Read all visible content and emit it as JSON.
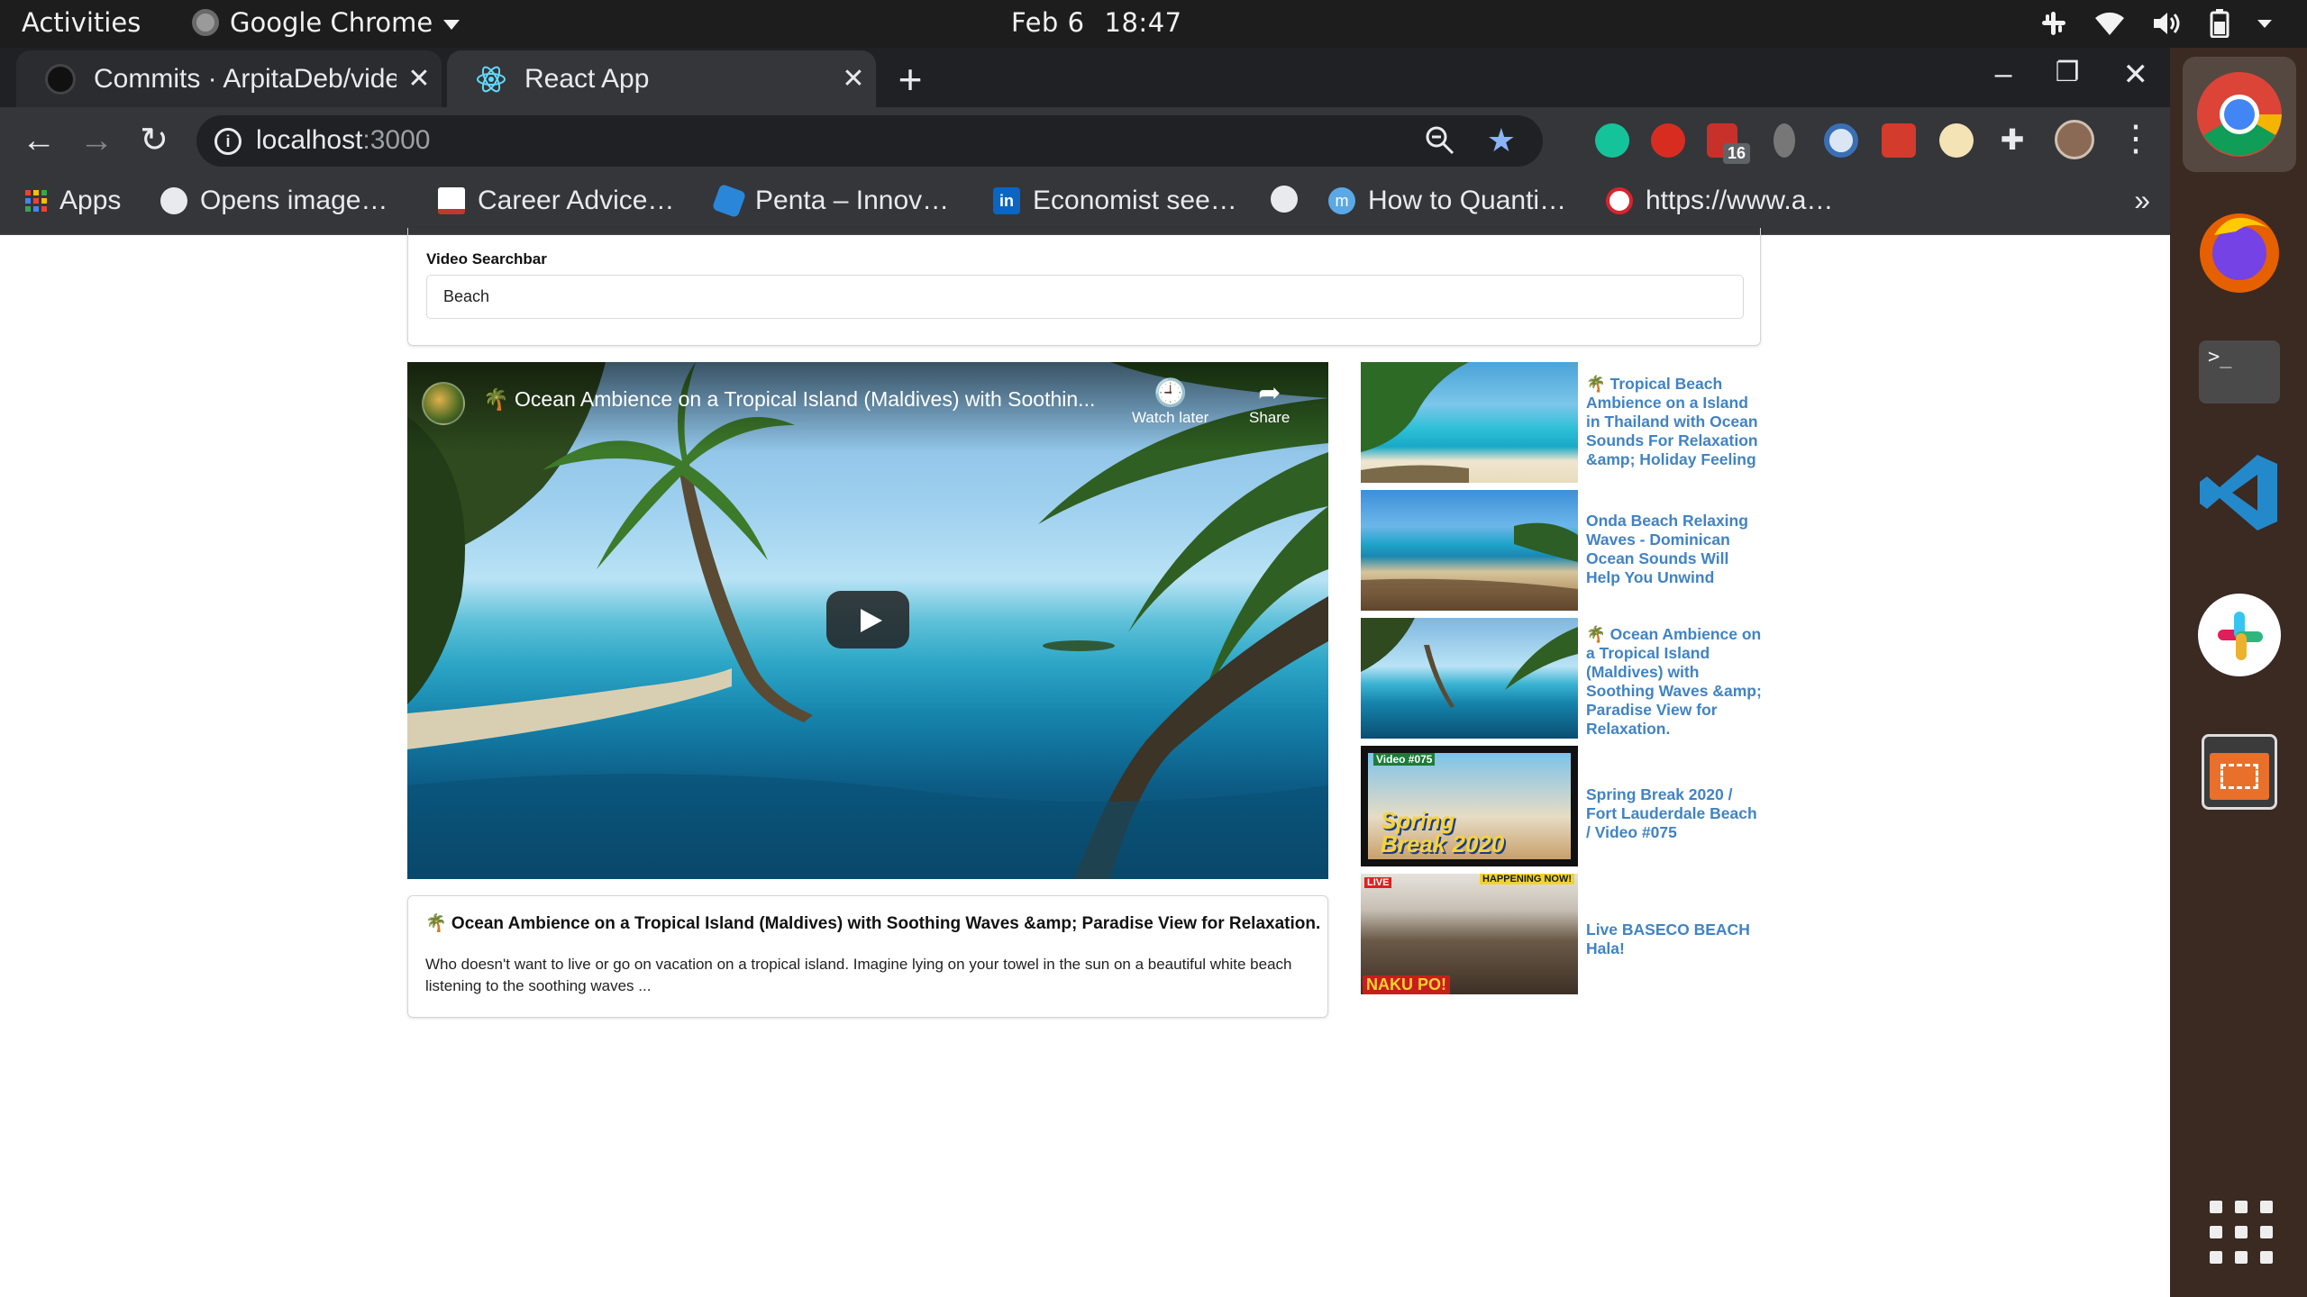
{
  "system_bar": {
    "activities": "Activities",
    "app_name": "Google Chrome",
    "date": "Feb 6",
    "time": "18:47"
  },
  "browser": {
    "tabs": [
      {
        "title": "Commits · ArpitaDeb/video",
        "active": false
      },
      {
        "title": "React App",
        "active": true
      }
    ],
    "url_host": "localhost",
    "url_port": ":3000",
    "extension_badge": "16",
    "bookmarks": [
      {
        "label": "Apps",
        "icon": "apps-grid-icon"
      },
      {
        "label": "Opens image…",
        "icon": "globe-icon"
      },
      {
        "label": "Career Advice…",
        "icon": "chart-icon"
      },
      {
        "label": "Penta – Innov…",
        "icon": "penta-icon"
      },
      {
        "label": "Economist see…",
        "icon": "linkedin-icon"
      },
      {
        "label": "",
        "icon": "globe-icon"
      },
      {
        "label": "How to Quanti…",
        "icon": "medium-icon"
      },
      {
        "label": "https://www.a…",
        "icon": "a-logo-icon"
      }
    ]
  },
  "search": {
    "label": "Video Searchbar",
    "value": "Beach"
  },
  "player": {
    "title": "🌴 Ocean Ambience on a Tropical Island (Maldives) with Soothin...",
    "watch_later": "Watch later",
    "share": "Share"
  },
  "video_detail": {
    "title": "🌴 Ocean Ambience on a Tropical Island (Maldives) with Soothing Waves &amp; Paradise View for Relaxation.",
    "description": "Who doesn't want to live or go on vacation on a tropical island. Imagine lying on your towel in the sun on a beautiful white beach listening to the soothing waves ..."
  },
  "video_list": [
    {
      "title": "🌴 Tropical Beach Ambience on a Island in Thailand with Ocean Sounds For Relaxation &amp; Holiday Feeling"
    },
    {
      "title": "Onda Beach Relaxing Waves - Dominican Ocean Sounds Will Help You Unwind"
    },
    {
      "title": "🌴 Ocean Ambience on a Tropical Island (Maldives) with Soothing Waves &amp; Paradise View for Relaxation."
    },
    {
      "title": "Spring Break 2020 / Fort Lauderdale Beach / Video #075",
      "thumb_text": "Spring Break 2020",
      "thumb_tag": "Video #075"
    },
    {
      "title": "Live BASECO BEACH Hala!",
      "thumb_live": "LIVE",
      "thumb_banner": "HAPPENING NOW!",
      "thumb_caption": "NAKU PO!"
    }
  ],
  "colors": {
    "link": "#4183c4",
    "chrome_dark": "#202124",
    "chrome_toolbar": "#35363a",
    "dock": "#3a2a22",
    "accent_star": "#8ab4f8"
  }
}
